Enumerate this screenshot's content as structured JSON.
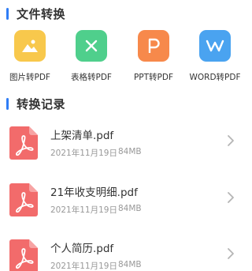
{
  "sections": {
    "tools_title": "文件转换",
    "records_title": "转换记录"
  },
  "tools": [
    {
      "label": "图片转PDF",
      "icon": "image-icon",
      "color": "#f8c84c"
    },
    {
      "label": "表格转PDF",
      "icon": "excel-x-icon",
      "color": "#4fcf8c"
    },
    {
      "label": "PPT转PDF",
      "icon": "ppt-p-icon",
      "color": "#f7894b"
    },
    {
      "label": "WORD转PDF",
      "icon": "word-w-icon",
      "color": "#4aa3f0"
    }
  ],
  "records": [
    {
      "name": "上架清单.pdf",
      "date": "2021年11月19日",
      "size": "84MB",
      "icon": "pdf-file-icon"
    },
    {
      "name": "21年收支明细.pdf",
      "date": "2021年11月19日",
      "size": "84MB",
      "icon": "pdf-file-icon"
    },
    {
      "name": "个人简历.pdf",
      "date": "2021年11月19日",
      "size": "84MB",
      "icon": "pdf-file-icon"
    }
  ],
  "colors": {
    "accent": "#2f7df6",
    "pdf_red": "#f26b6b",
    "text_primary": "#333333",
    "text_secondary": "#999999"
  }
}
